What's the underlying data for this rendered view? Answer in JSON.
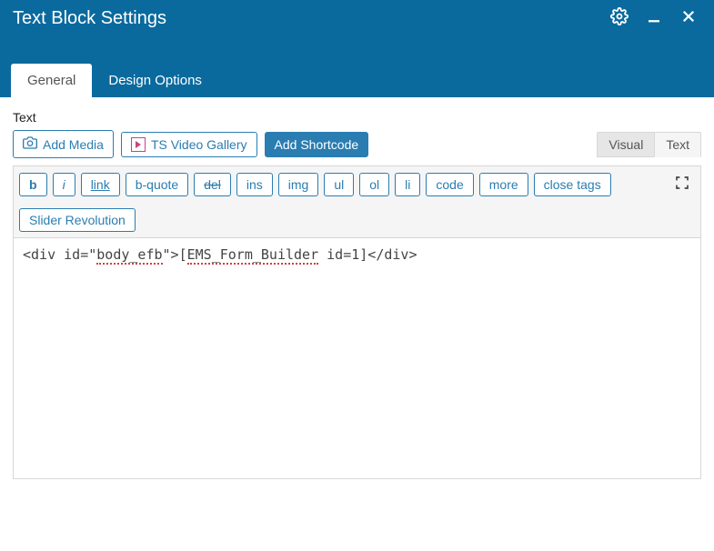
{
  "header": {
    "title": "Text Block Settings",
    "icons": {
      "settings": "gear",
      "minimize": "minimize",
      "close": "close"
    }
  },
  "tabs": {
    "general": "General",
    "design_options": "Design Options"
  },
  "field_label": "Text",
  "media_buttons": {
    "add_media": "Add Media",
    "ts_video_gallery": "TS Video Gallery",
    "add_shortcode": "Add Shortcode"
  },
  "mode_tabs": {
    "visual": "Visual",
    "text": "Text"
  },
  "quicktags": {
    "b": "b",
    "i": "i",
    "link": "link",
    "bquote": "b-quote",
    "del": "del",
    "ins": "ins",
    "img": "img",
    "ul": "ul",
    "ol": "ol",
    "li": "li",
    "code": "code",
    "more": "more",
    "close": "close tags",
    "slider_revolution": "Slider Revolution"
  },
  "editor": {
    "pre1": "<div id=\"",
    "squig1": "body_efb",
    "mid": "\">[",
    "squig2": "EMS_Form_Builder",
    "post": " id=1]</div>"
  }
}
